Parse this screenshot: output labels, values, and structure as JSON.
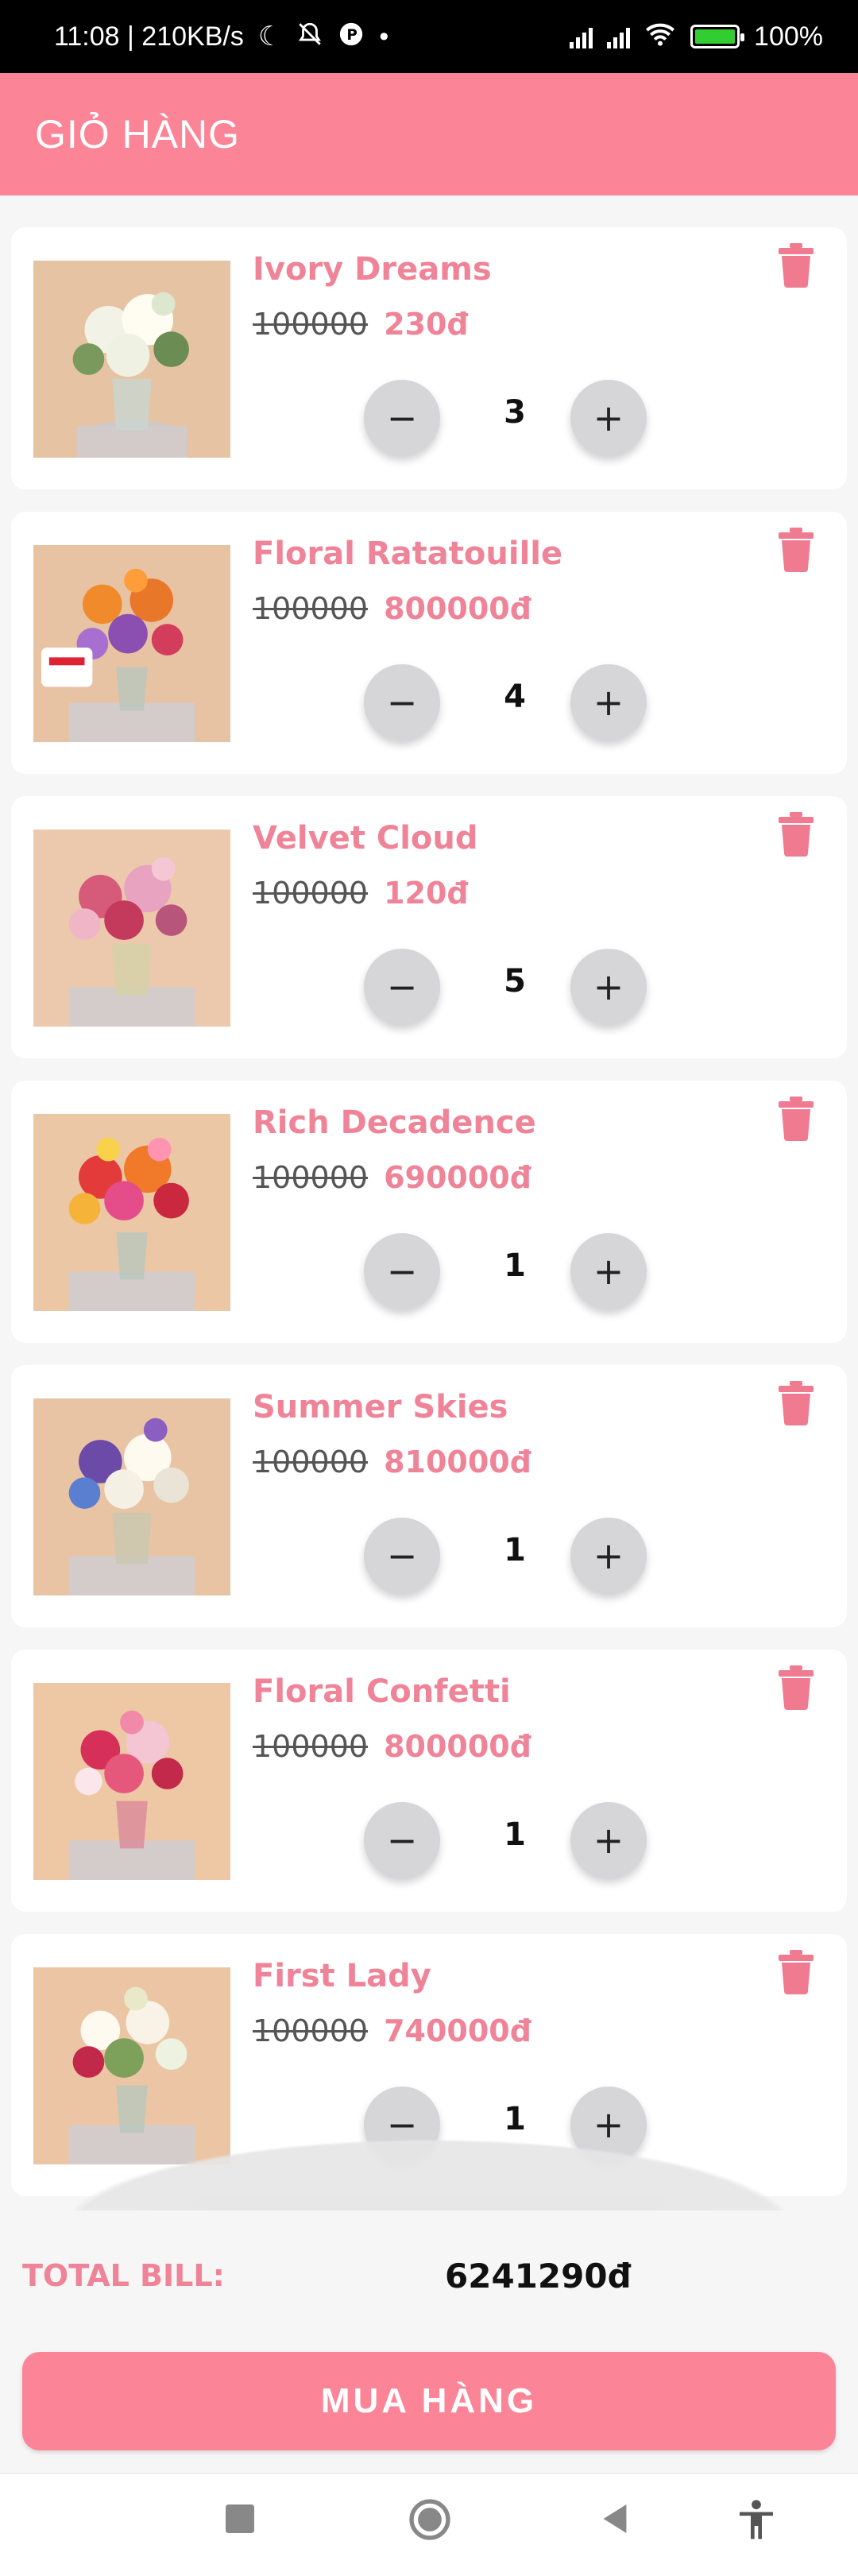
{
  "status_bar": {
    "time_speed": "11:08 | 210KB/s",
    "battery": "100%",
    "icons": [
      "moon-icon",
      "bell-off-icon",
      "app-icon",
      "dot-icon",
      "signal-icon",
      "signal-icon",
      "wifi-icon",
      "battery-icon"
    ]
  },
  "app_bar": {
    "title": "GIỎ HÀNG"
  },
  "cart": {
    "items": [
      {
        "name": "Ivory Dreams",
        "old_price": "100000",
        "price": "230đ",
        "quantity": "3"
      },
      {
        "name": "Floral Ratatouille",
        "old_price": "100000",
        "price": "800000đ",
        "quantity": "4"
      },
      {
        "name": "Velvet Cloud",
        "old_price": "100000",
        "price": "120đ",
        "quantity": "5"
      },
      {
        "name": "Rich Decadence",
        "old_price": "100000",
        "price": "690000đ",
        "quantity": "1"
      },
      {
        "name": "Summer Skies",
        "old_price": "100000",
        "price": "810000đ",
        "quantity": "1"
      },
      {
        "name": "Floral Confetti",
        "old_price": "100000",
        "price": "800000đ",
        "quantity": "1"
      },
      {
        "name": "First Lady",
        "old_price": "100000",
        "price": "740000đ",
        "quantity": "1"
      }
    ],
    "minus_symbol": "−",
    "plus_symbol": "+"
  },
  "total": {
    "label": "TOTAL BILL:",
    "value": "6241290đ"
  },
  "buy_button": {
    "label": "MUA HÀNG"
  },
  "colors": {
    "accent": "#fb8597",
    "text_pink": "#ef8397"
  },
  "nav_bar": {
    "icons": [
      "square-icon",
      "home-circle-icon",
      "back-triangle-icon",
      "accessibility-icon"
    ]
  }
}
